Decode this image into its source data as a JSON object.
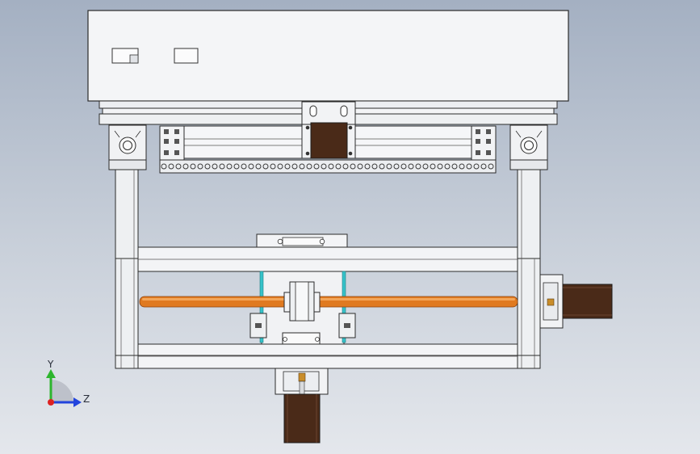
{
  "viewport": {
    "background_top": "#a4b0c2",
    "background_bottom": "#e4e7ec"
  },
  "colors": {
    "frame_fill": "#f4f5f7",
    "frame_stroke": "#2b2b2b",
    "motor_body": "#4a2a18",
    "lead_screw": "#e07a20",
    "lead_screw_highlight": "#f3a558",
    "guide_cyan": "#36c2c9",
    "coupling_brass": "#c98d2a"
  },
  "parts": [
    "top-housing",
    "x-axis-carriage",
    "x-axis-stepper-motor",
    "left-column",
    "right-column",
    "z-axis-lead-screw",
    "z-axis-carriage",
    "z-axis-stepper-motor",
    "y-axis-stepper-motor"
  ],
  "triad": {
    "y_label": "Y",
    "z_label": "Z",
    "y_color": "#2db52d",
    "z_color": "#2244dd",
    "origin_color": "#dd2222"
  }
}
